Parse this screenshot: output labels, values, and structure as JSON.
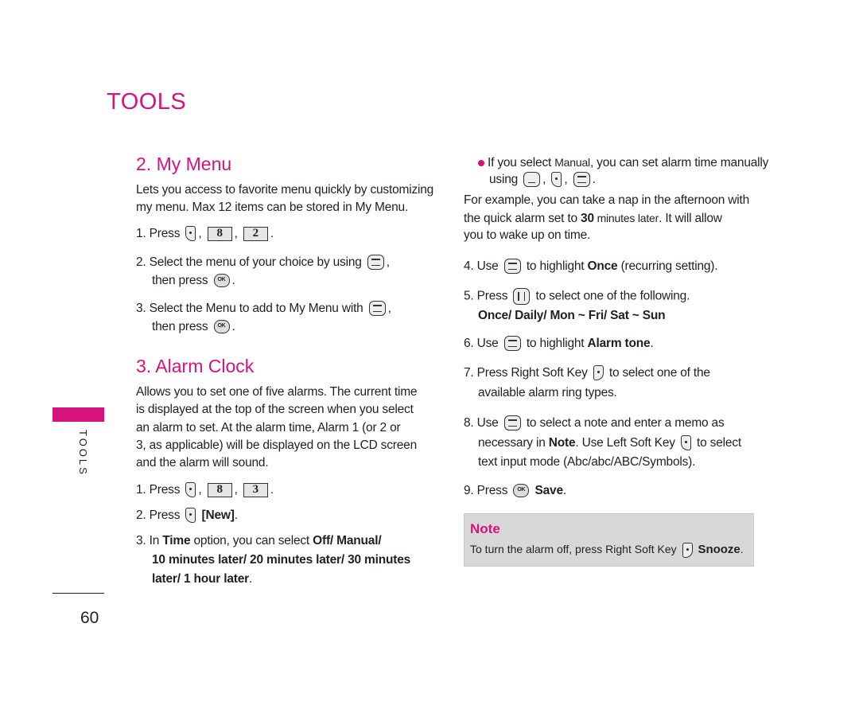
{
  "section_title": "TOOLS",
  "sidebar_label": "TOOLS",
  "page_number": "60",
  "colors": {
    "accent": "#d4137f",
    "note_bg": "#d8d8d8"
  },
  "my_menu": {
    "heading": "2. My Menu",
    "intro": [
      "Lets you access to favorite menu quickly by customizing",
      "my menu. Max 12 items can be stored in My Menu."
    ],
    "step1": {
      "label": "1. Press",
      "keys": [
        "8",
        "2"
      ]
    },
    "step2": {
      "line1": "2. Select the menu of your choice by using",
      "line2": "then press"
    },
    "step3": {
      "line1": "3. Select the Menu to add to My Menu with",
      "line2": "then press"
    }
  },
  "alarm_clock": {
    "heading": "3. Alarm Clock",
    "intro": [
      "Allows you to set one of five alarms. The current time",
      "is displayed at the top of the screen when you select",
      "an alarm to set. At the alarm time, Alarm 1 (or 2 or",
      "3, as applicable) will be displayed on the LCD screen",
      "and the alarm will sound."
    ],
    "step1": {
      "label": "1. Press",
      "keys": [
        "8",
        "3"
      ]
    },
    "step2": {
      "label": "2. Press",
      "new": "[New]"
    },
    "step3": {
      "prefix": "3. In ",
      "time": "Time",
      "mid": " option, you can select ",
      "options1": "Off/ Manual/",
      "options2": "10 minutes later/ 20 minutes later/ 30 minutes",
      "options3": "later/ 1 hour later",
      "end": "."
    },
    "bullet": {
      "pre": "If you select ",
      "manual": "Manual",
      "post": ", you can set alarm time manually",
      "using": "using"
    },
    "example": {
      "line1": "For example, you can take a nap in the afternoon with",
      "line2_pre": "the quick alarm set to ",
      "line2_num": "30",
      "line2_unit": " minutes later",
      "line2_post": ". It will allow",
      "line3": "you to wake up on time."
    },
    "step4": {
      "pre": "4. Use",
      "mid": "to highlight ",
      "bold": "Once",
      "post": " (recurring setting)."
    },
    "step5": {
      "pre": "5. Press",
      "post": "to select one of the following.",
      "options": "Once/ Daily/ Mon ~ Fri/ Sat ~ Sun"
    },
    "step6": {
      "pre": "6. Use",
      "mid": "to highlight ",
      "bold": "Alarm tone",
      "post": "."
    },
    "step7": {
      "pre": "7. Press Right Soft Key",
      "post": "to select one of the",
      "line2": "available alarm ring types."
    },
    "step8": {
      "pre": "8. Use",
      "post": "to select a note and enter a memo as",
      "l2pre": "necessary in ",
      "l2bold": "Note",
      "l2post": ". Use Left Soft Key",
      "l2end": "to select",
      "line3": "text input mode (Abc/abc/ABC/Symbols)."
    },
    "step9": {
      "pre": "9. Press",
      "bold": "Save",
      "post": "."
    }
  },
  "note": {
    "title": "Note",
    "text": "To turn the alarm off, press Right Soft Key",
    "bold": "Snooze",
    "end": "."
  },
  "ok_key_label": "OK"
}
